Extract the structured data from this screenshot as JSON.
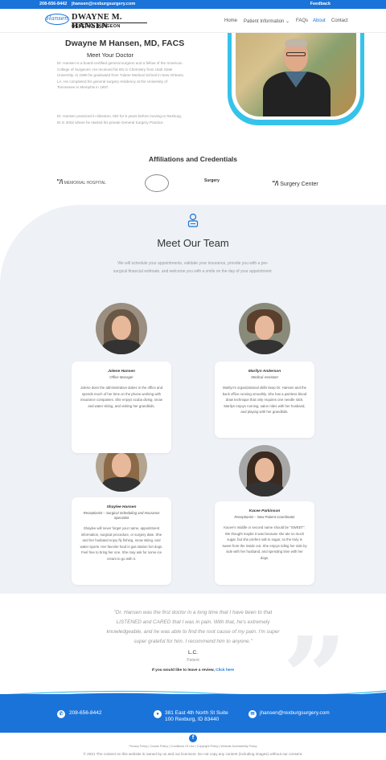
{
  "topbar": {
    "phone": "208-656-8442",
    "email": "jhansen@rexburgsurgery.com",
    "feedback": "Feedback"
  },
  "logo": {
    "mark": "Hansen",
    "name": "DWAYNE M. HANSEN",
    "subtitle": "GENERAL SURGEON"
  },
  "nav": {
    "home": "Home",
    "patient_info": "Patient Information ⌄",
    "faqs": "FAQs",
    "about": "About",
    "contact": "Contact"
  },
  "hero": {
    "title": "Dwayne M Hansen, MD, FACS",
    "subtitle": "Meet Your Doctor",
    "bio1": "Dr. Hansen is a board-certified general surgeon and a fellow of the American College of Surgeons. He received his BS in Chemistry from Utah State University. In 1990 he graduated from Tulane Medical School in New Orleans, LA. He completed his general surgery residency at the University of Tennessee in Memphis in 1997.",
    "bio2": "Dr. Hansen practiced in Sikeston, MO for 5 years before moving to Rexburg, ID in 2002 where he started his private General Surgery Practice."
  },
  "affiliations": {
    "title": "Affiliations and Credentials",
    "logo1": "MEMORIAL HOSPITAL",
    "logo3": "Surgery",
    "logo4": "Surgery Center"
  },
  "team": {
    "title": "Meet Our Team",
    "intro": "We will schedule your appointments, validate your insurance, provide you with a pre-surgical financial estimate, and welcome you with a smile on the day of your appointment.",
    "members": [
      {
        "name": "Jolene Hansen",
        "role": "Office Manager",
        "desc": "Jolene does the administrative duties in the office and spends much of her time on the phone working with insurance companies. She enjoys scuba diving, snow and water skiing, and visiting her grandkids."
      },
      {
        "name": "Marilyn Anderson",
        "role": "Medical Assistant",
        "desc": "Marilyn's organizational skills keep Dr. Hansen and the back office running smoothly. She has a painless blood draw technique that only requires one needle stick. Marilyn enjoys running, salon rides with her husband, and playing with her grandkids."
      },
      {
        "name": "Shaylee Hansen",
        "role": "Receptionist – Surgical Scheduling and Insurance Specialist",
        "desc": "Shaylee will never forget your name, appointment information, surgical procedure, or surgery date. She and her husband enjoy fly fishing, snow skiing, and water sports. Her favorite food is gas station hot dogs. Feel free to bring her one. She may ask for some ice cream to go with it."
      },
      {
        "name": "Kacee Parkinson",
        "role": "Receptionist – New Patient Coordinator",
        "desc": "Kacee's middle or second name should be \"SWEET\". We thought maybe it was because she ate so much sugar, but she prefers salt to sugar, so the truly is sweet from the inside out. She enjoys riding her side by side with her husband, and spending time with her dogs."
      }
    ]
  },
  "testimonial": {
    "quote": "\"Dr. Hansen was the first doctor in a long time that I have been to that LISTENED and CARED that I was in pain. With that, he's extremely knowledgeable, and he was able to find the root cause of my pain. I'm super super grateful for him. I recommend him to anyone.\"",
    "author": "L.C.",
    "author_role": "Patient",
    "review_prompt": "If you would like to leave a review, ",
    "review_link": "Click here"
  },
  "footer": {
    "phone": "208-656-8442",
    "address_line1": "381 East 4th North St Suite",
    "address_line2": "100 Rexburg, ID 83440",
    "email": "jhansen@rexburgsurgery.com",
    "links": "Privacy Policy | Cookie Policy | Conditions Of Use | Copyright Policy | Website Accessibility Policy",
    "copyright": "© 2021 The content on this website is owned by us and our licensors. Do not copy any content (including images) without our consent."
  },
  "colors": {
    "brand_blue": "#1a73d9",
    "accent_cyan": "#35c3ea",
    "team_bg": "#eef1f5"
  },
  "icons": {
    "team": "clipboard-person-icon",
    "phone": "phone-icon",
    "address": "map-pin-icon",
    "email": "envelope-icon",
    "facebook": "facebook-icon"
  }
}
